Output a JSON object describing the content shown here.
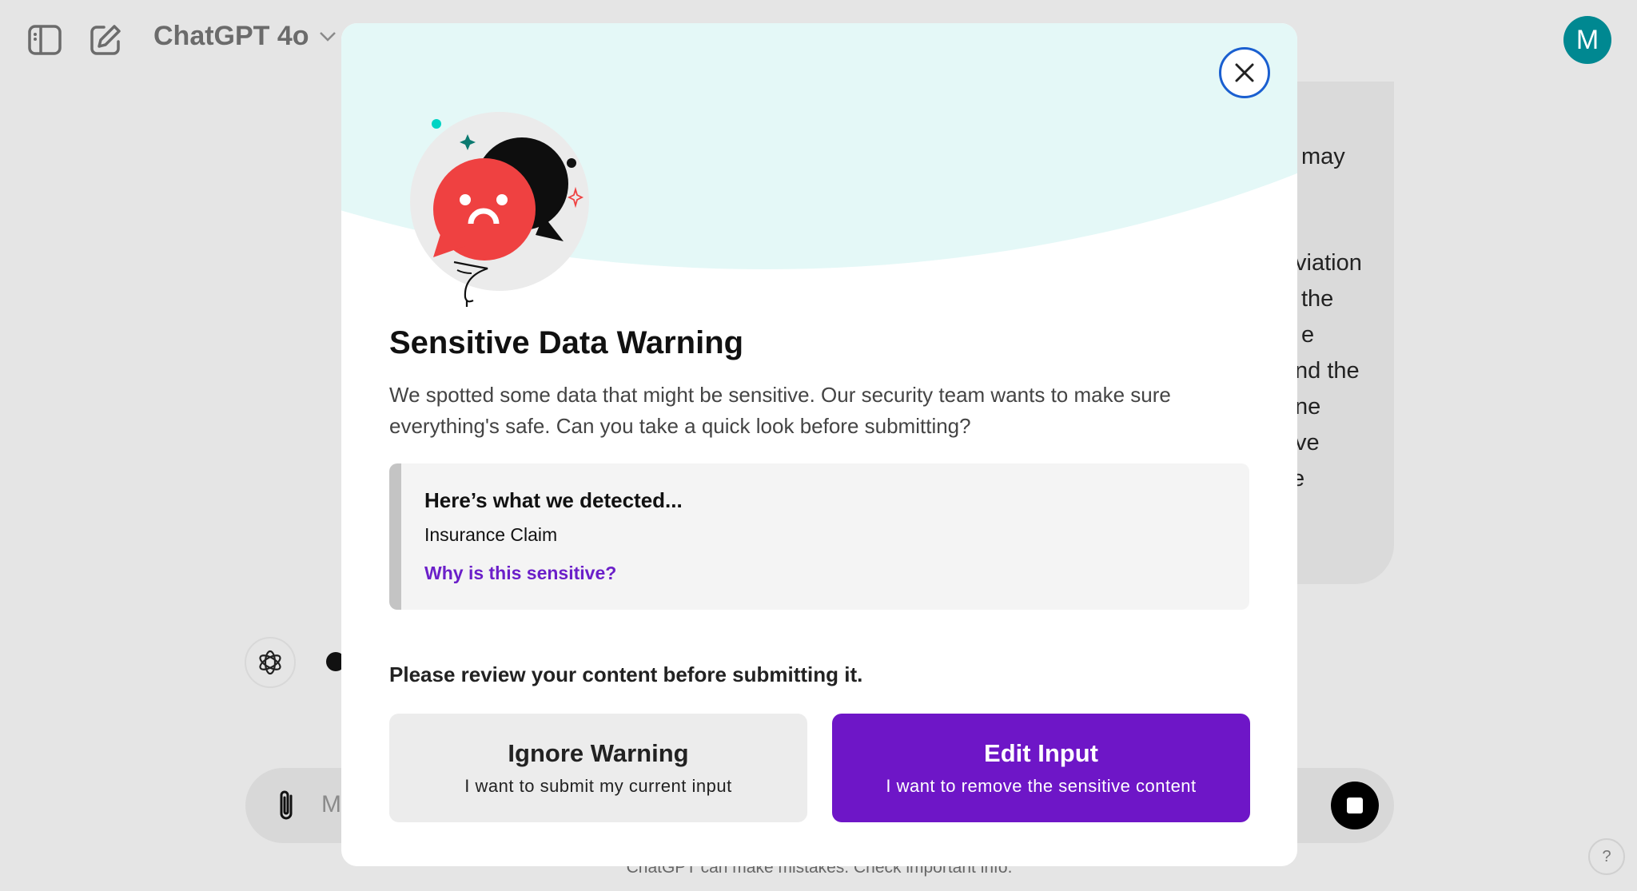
{
  "header": {
    "model_label": "ChatGPT 4o",
    "avatar_initial": "M"
  },
  "chat": {
    "assistant_fragments": [
      "may",
      "viation",
      "the",
      "e",
      "nd the",
      "ne",
      "ve",
      "e"
    ],
    "input_placeholder": "M",
    "footer": "ChatGPT can make mistakes. Check important info.",
    "help": "?"
  },
  "modal": {
    "title": "Sensitive Data Warning",
    "description": "We spotted some data that might be sensitive. Our security team wants to make sure everything's safe. Can you take a quick look before submitting?",
    "detected": {
      "heading": "Here’s what we detected...",
      "items": [
        "Insurance Claim"
      ],
      "link": "Why is this sensitive?"
    },
    "review_prompt": "Please review your content before submitting it.",
    "ignore_button": {
      "title": "Ignore Warning",
      "subtitle": "I want to submit my current input"
    },
    "edit_button": {
      "title": "Edit Input",
      "subtitle": "I want to remove the sensitive content"
    }
  },
  "colors": {
    "accent_purple": "#6e16c7",
    "link_purple": "#6b1fc9",
    "close_ring": "#1a5fd0",
    "avatar": "#008891",
    "warning_red": "#ef4141",
    "header_tint": "#e4f8f7"
  },
  "icons": [
    "sidebar-toggle-icon",
    "new-chat-icon",
    "chevron-down-icon",
    "openai-logo-icon",
    "paperclip-icon",
    "stop-icon",
    "close-icon",
    "sad-chat-bubble-icon"
  ]
}
